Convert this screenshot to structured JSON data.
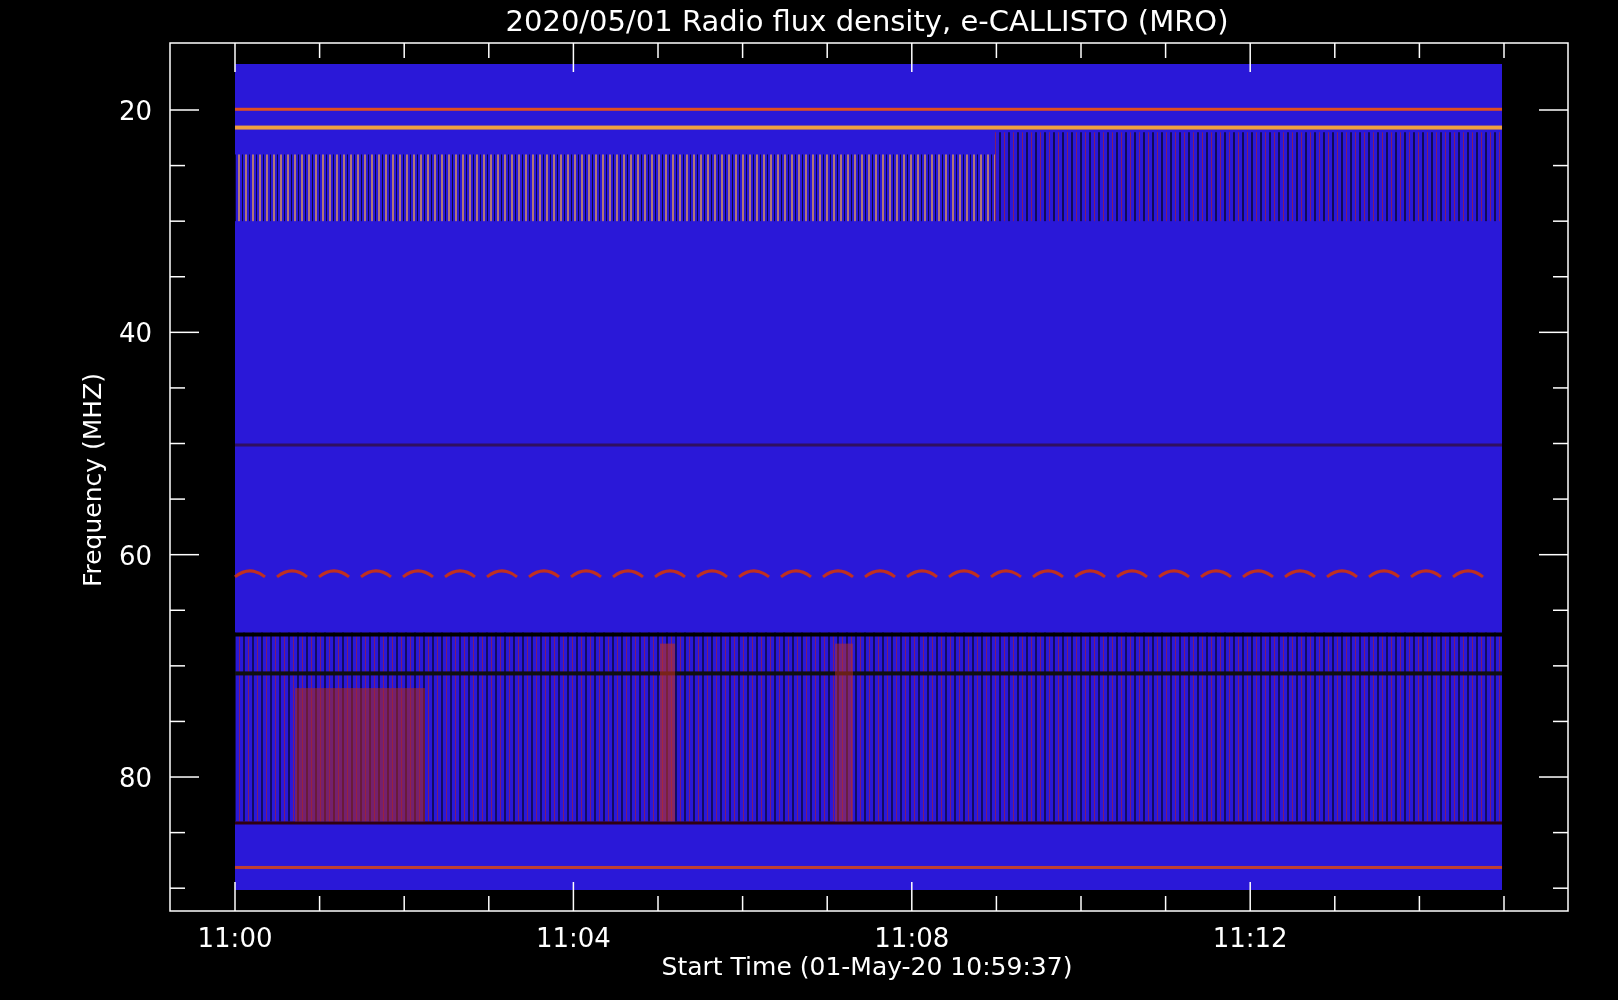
{
  "plot": {
    "title": "2020/05/01  Radio flux density, e-CALLISTO (MRO)",
    "y_axis": {
      "label": "Frequency (MHZ)",
      "ticks": [
        "20",
        "40",
        "60",
        "80"
      ]
    },
    "x_axis": {
      "label": "Start Time (01-May-20 10:59:37)",
      "ticks": [
        "11:00",
        "11:04",
        "11:08",
        "11:12"
      ]
    }
  }
}
